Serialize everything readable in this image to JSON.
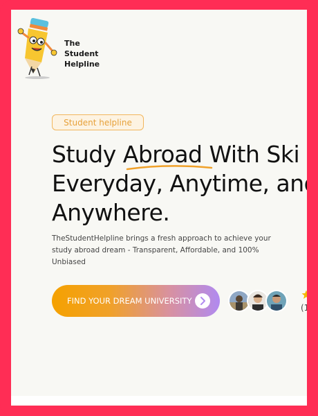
{
  "brand": {
    "name_line1": "The",
    "name_line2": "Student",
    "name_line3": "Helpline"
  },
  "hero": {
    "pill_label": "Student helpline",
    "headline_line1": "Study Abroad With Ski",
    "headline_line2": "Everyday, Anytime, and",
    "headline_line3": "Anywhere.",
    "description": "TheStudentHelpline brings a fresh approach to achieve your study abroad dream - Transparent, Affordable, and 100% Unbiased",
    "cta_label": "FIND YOUR DREAM UNIVERSITY"
  },
  "social_proof": {
    "rating_partial": "(1"
  },
  "colors": {
    "frame": "#ff2d55",
    "accent_orange": "#f5a100",
    "accent_purple": "#b08af0",
    "pill_border": "#f2b65c"
  },
  "icons": {
    "mascot": "pencil-mascot-icon",
    "cta_arrow": "chevron-right-icon",
    "star": "star-icon"
  }
}
